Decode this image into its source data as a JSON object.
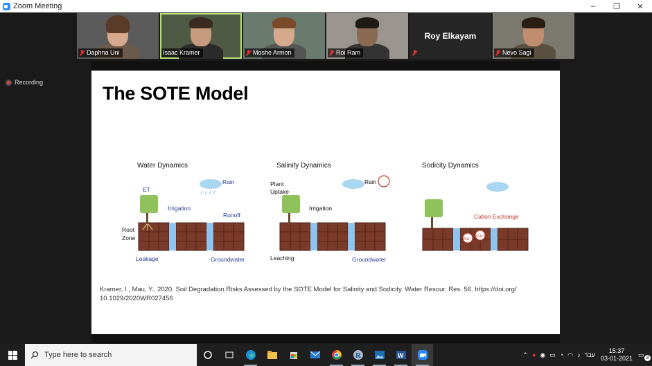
{
  "window": {
    "title": "Zoom Meeting",
    "minimize": "–",
    "restore": "❐",
    "close": "✕"
  },
  "participants": [
    {
      "name": "Daphna Uni",
      "active": false
    },
    {
      "name": "Isaac Kramer",
      "active": true
    },
    {
      "name": "Moshe Armon",
      "active": false
    },
    {
      "name": "Roi Ram",
      "active": false
    },
    {
      "name": "Roy Elkayam",
      "active": false,
      "video": false
    },
    {
      "name": "Nevo Sagi",
      "active": false
    }
  ],
  "recording_label": "Recording",
  "slide": {
    "title": "The SOTE Model",
    "sections": {
      "water": {
        "title": "Water Dynamics",
        "et": "ET",
        "rain": "Rain",
        "irrigation": "Irrigation",
        "runoff": "Runoff",
        "root": "Root",
        "zone": "Zone",
        "leakage": "Leakage",
        "groundwater": "Groundwater"
      },
      "salinity": {
        "title": "Salinity Dynamics",
        "plant": "Plant",
        "uptake": "Uptake",
        "rain": "Rain",
        "irrigation": "Irrigation",
        "leaching": "Leaching",
        "groundwater": "Groundwater"
      },
      "sodicity": {
        "title": "Sodicity Dynamics",
        "cation_exchange": "Cation Exchange",
        "na": "Na⁺",
        "ca": "Ca²⁺"
      }
    },
    "reference_line1": "Kramer, I., Mau, Y., 2020. Soil Degradation Risks Assessed by the SOTE Model for Salinity and Sodicity. Water Resour. Res. 56. https://doi.org/",
    "reference_line2": "10.1029/2020WR027456"
  },
  "taskbar": {
    "search_placeholder": "Type here to search",
    "language": "עבר",
    "time": "15:37",
    "date": "03-01-2021",
    "notifications": "3"
  },
  "colors": {
    "soil": "#7a3a2a",
    "soil_line": "#4a1e14",
    "water": "#8fc4ee",
    "tree": "#8fc25a",
    "label_blue": "#1f3a93",
    "accent_red": "#c0392b"
  }
}
